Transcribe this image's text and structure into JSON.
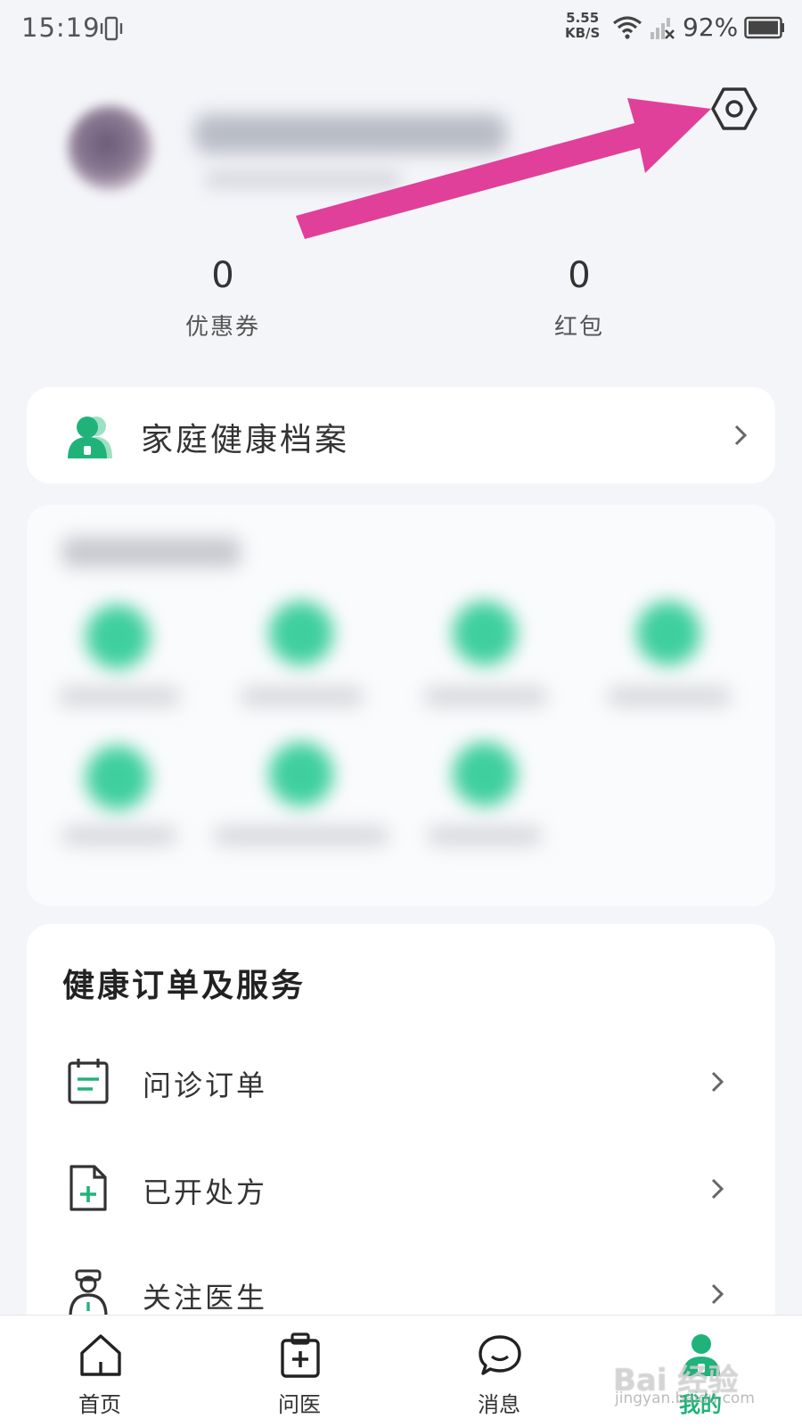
{
  "status_bar": {
    "time": "15:19",
    "speed_value": "5.55",
    "speed_unit": "KB/S",
    "battery": "92%",
    "icons": [
      "vibrate-icon",
      "wifi-icon",
      "signal-icon",
      "battery-icon"
    ]
  },
  "profile": {
    "settings_icon": "settings-hexagon-icon"
  },
  "stats": [
    {
      "value": "0",
      "label": "优惠券"
    },
    {
      "value": "0",
      "label": "红包"
    }
  ],
  "health_record": {
    "label": "家庭健康档案",
    "icon": "family-person-icon"
  },
  "orders": {
    "title": "健康订单及服务",
    "items": [
      {
        "label": "问诊订单",
        "icon": "calendar-list-icon"
      },
      {
        "label": "已开处方",
        "icon": "prescription-doc-icon"
      },
      {
        "label": "关注医生",
        "icon": "doctor-icon"
      }
    ]
  },
  "bottom_nav": {
    "items": [
      {
        "label": "首页",
        "icon": "home-icon"
      },
      {
        "label": "问医",
        "icon": "medical-kit-icon"
      },
      {
        "label": "消息",
        "icon": "chat-icon"
      },
      {
        "label": "我的",
        "icon": "profile-icon",
        "active": true
      }
    ]
  },
  "colors": {
    "accent": "#1fb37a",
    "annotation_arrow": "#e0409a",
    "background": "#f4f5f9"
  },
  "watermark": {
    "text": "Bai 经验",
    "sub": "jingyan.baidu.com"
  }
}
